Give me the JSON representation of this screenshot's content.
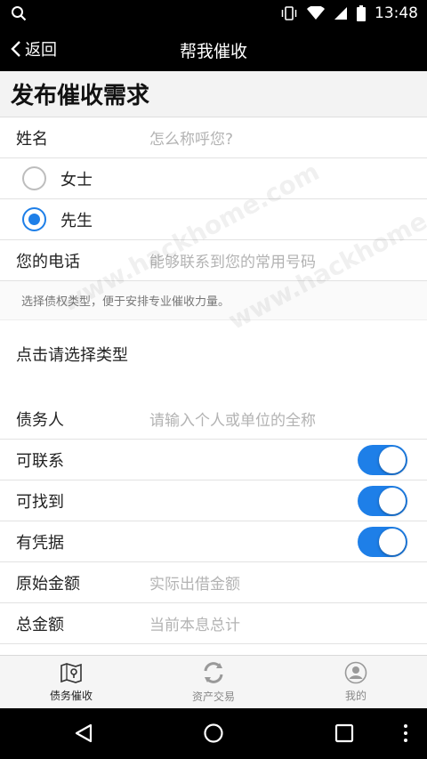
{
  "status_bar": {
    "time": "13:48"
  },
  "nav": {
    "back_label": "返回",
    "title": "帮我催收"
  },
  "page": {
    "heading": "发布催收需求"
  },
  "form": {
    "name_label": "姓名",
    "name_placeholder": "怎么称呼您?",
    "gender_options": [
      {
        "label": "女士",
        "checked": false
      },
      {
        "label": "先生",
        "checked": true
      }
    ],
    "phone_label": "您的电话",
    "phone_placeholder": "能够联系到您的常用号码",
    "type_hint": "选择债权类型，便于安排专业催收力量。",
    "type_select": "点击请选择类型",
    "debtor_label": "债务人",
    "debtor_placeholder": "请输入个人或单位的全称",
    "toggles": [
      {
        "label": "可联系",
        "on": true
      },
      {
        "label": "可找到",
        "on": true
      },
      {
        "label": "有凭据",
        "on": true
      }
    ],
    "orig_amount_label": "原始金额",
    "orig_amount_placeholder": "实际出借金额",
    "total_amount_label": "总金额",
    "total_amount_placeholder": "当前本息总计"
  },
  "watermark": "www.hackhome.com",
  "tabs": [
    {
      "label": "债务催收",
      "icon": "map-pin-icon",
      "active": true
    },
    {
      "label": "资产交易",
      "icon": "refresh-icon",
      "active": false
    },
    {
      "label": "我的",
      "icon": "user-icon",
      "active": false
    }
  ],
  "colors": {
    "accent": "#1e7fe8"
  }
}
